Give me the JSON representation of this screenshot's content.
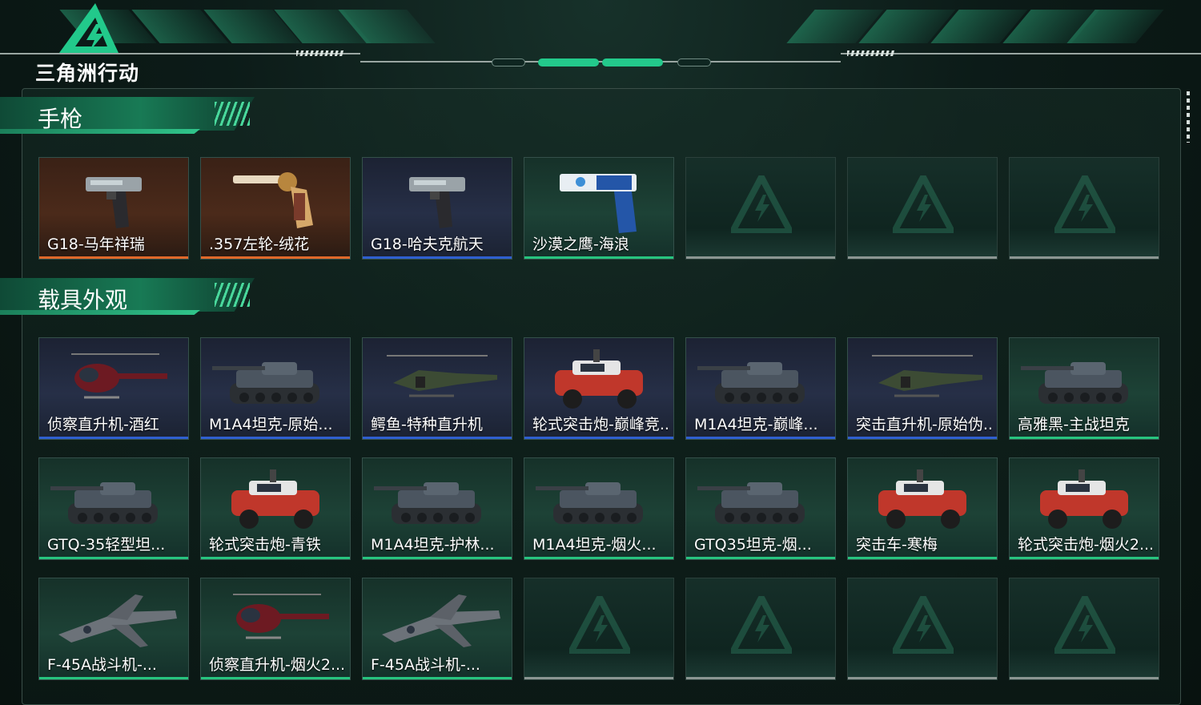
{
  "brand": {
    "logo_text": "三角洲行动"
  },
  "colors": {
    "rarity_orange": "#e0692a",
    "rarity_blue": "#2f5fd0",
    "rarity_green": "#27c47f",
    "rarity_empty": "#8b9692",
    "accent": "#23c98b"
  },
  "sections": [
    {
      "title": "手枪",
      "items": [
        {
          "label": "G18-马年祥瑞",
          "rarity": "orange",
          "icon": "pistol-icon"
        },
        {
          "label": ".357左轮-绒花",
          "rarity": "orange",
          "icon": "revolver-icon"
        },
        {
          "label": "G18-哈夫克航天",
          "rarity": "blue",
          "icon": "pistol-icon"
        },
        {
          "label": "沙漠之鹰-海浪",
          "rarity": "green",
          "icon": "desert-eagle-icon"
        },
        {
          "label": "",
          "rarity": "empty"
        },
        {
          "label": "",
          "rarity": "empty"
        },
        {
          "label": "",
          "rarity": "empty"
        }
      ]
    },
    {
      "title": "载具外观",
      "items": [
        {
          "label": "侦察直升机-酒红",
          "rarity": "blue",
          "icon": "helicopter-icon"
        },
        {
          "label": "M1A4坦克-原始...",
          "rarity": "blue",
          "icon": "tank-icon"
        },
        {
          "label": "鳄鱼-特种直升机",
          "rarity": "blue",
          "icon": "attack-helicopter-icon"
        },
        {
          "label": "轮式突击炮-巅峰竞...",
          "rarity": "blue",
          "icon": "armored-car-icon"
        },
        {
          "label": "M1A4坦克-巅峰...",
          "rarity": "blue",
          "icon": "tank-icon"
        },
        {
          "label": "突击直升机-原始伪...",
          "rarity": "blue",
          "icon": "attack-helicopter-icon"
        },
        {
          "label": "高雅黑-主战坦克",
          "rarity": "green",
          "icon": "tank-icon"
        },
        {
          "label": "GTQ-35轻型坦...",
          "rarity": "green",
          "icon": "tank-icon"
        },
        {
          "label": "轮式突击炮-青铁",
          "rarity": "green",
          "icon": "armored-car-icon"
        },
        {
          "label": "M1A4坦克-护林...",
          "rarity": "green",
          "icon": "tank-icon"
        },
        {
          "label": "M1A4坦克-烟火...",
          "rarity": "green",
          "icon": "tank-icon"
        },
        {
          "label": "GTQ35坦克-烟...",
          "rarity": "green",
          "icon": "tank-icon"
        },
        {
          "label": "突击车-寒梅",
          "rarity": "green",
          "icon": "armored-car-icon"
        },
        {
          "label": "轮式突击炮-烟火2...",
          "rarity": "green",
          "icon": "armored-car-icon"
        },
        {
          "label": "F-45A战斗机-...",
          "rarity": "green",
          "icon": "jet-icon"
        },
        {
          "label": "侦察直升机-烟火2...",
          "rarity": "green",
          "icon": "helicopter-icon"
        },
        {
          "label": "F-45A战斗机-...",
          "rarity": "green",
          "icon": "jet-icon"
        },
        {
          "label": "",
          "rarity": "empty"
        },
        {
          "label": "",
          "rarity": "empty"
        },
        {
          "label": "",
          "rarity": "empty"
        },
        {
          "label": "",
          "rarity": "empty"
        }
      ]
    }
  ]
}
